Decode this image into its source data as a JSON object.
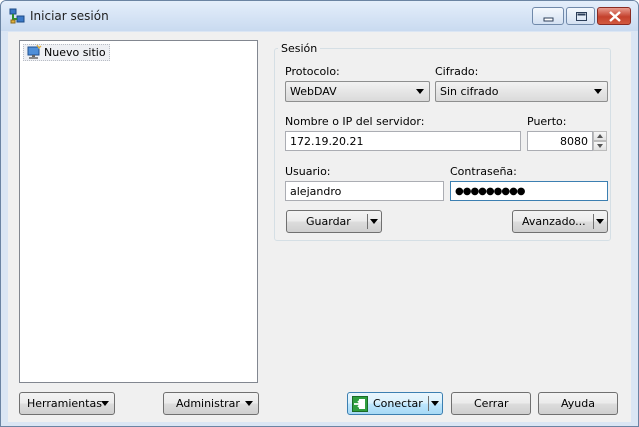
{
  "window": {
    "title": "Iniciar sesión",
    "icon": "network-computer-icon"
  },
  "site_tree": {
    "items": [
      {
        "label": "Nuevo sitio",
        "icon": "computer-site-icon",
        "selected": true
      }
    ]
  },
  "session": {
    "group_title": "Sesión",
    "protocol": {
      "label": "Protocolo:",
      "value": "WebDAV"
    },
    "encryption": {
      "label": "Cifrado:",
      "value": "Sin cifrado"
    },
    "host": {
      "label": "Nombre o IP del servidor:",
      "value": "172.19.20.21"
    },
    "port": {
      "label": "Puerto:",
      "value": "8080"
    },
    "user": {
      "label": "Usuario:",
      "value": "alejandro"
    },
    "password": {
      "label": "Contraseña:",
      "value": "●●●●●●●●●"
    },
    "save_label": "Guardar",
    "advanced_label": "Avanzado..."
  },
  "footer": {
    "tools_label": "Herramientas",
    "manage_label": "Administrar",
    "connect_label": "Conectar",
    "close_label": "Cerrar",
    "help_label": "Ayuda"
  },
  "colors": {
    "title_bar": "#c9daf0",
    "close_button": "#c4412d",
    "focus_border": "#3c7fb1"
  }
}
